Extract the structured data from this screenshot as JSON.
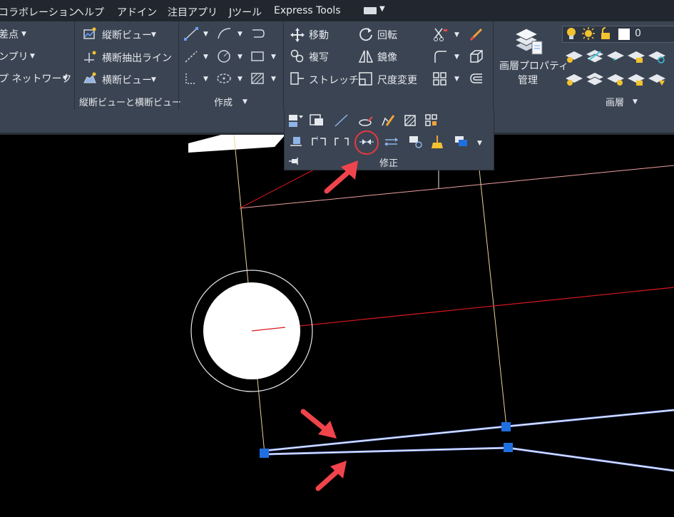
{
  "menu": {
    "items": [
      "コラボレーション",
      "ヘルプ",
      "アドイン",
      "注目アプリ",
      "Jツール",
      "Express Tools"
    ]
  },
  "ribbon": {
    "left_col": [
      "差点",
      "ンプリ",
      "プ ネットワーク"
    ],
    "views": {
      "items": [
        "縦断ビュー",
        "横断抽出ライン",
        "横断ビュー"
      ],
      "group_label": "縦断ビューと横断ビュー"
    },
    "create": {
      "group_label": "作成"
    },
    "modify": {
      "items": [
        "移動",
        "回転",
        "複写",
        "鏡像",
        "ストレッチ",
        "尺度変更"
      ],
      "group_label": "修正"
    },
    "layer_props": {
      "label_line1": "画層プロパティ",
      "label_line2": "管理"
    },
    "layers": {
      "current_layer": "0",
      "group_label": "画層"
    }
  },
  "colors": {
    "ribbon_bg": "#3b4452",
    "menubar_bg": "#22272f",
    "highlight_circle": "#e8383d",
    "annotation_arrow": "#f0444c",
    "grip": "#1f6fe0",
    "selected_line": "#8fa8ff"
  },
  "icons": [
    "move-icon",
    "rotate-icon",
    "copy-icon",
    "mirror-icon",
    "stretch-icon",
    "scale-icon",
    "trim-icon",
    "fillet-icon",
    "array-icon",
    "offset-icon",
    "join-icon",
    "layer-properties-icon",
    "lightbulb-icon",
    "sun-icon",
    "lock-icon"
  ]
}
